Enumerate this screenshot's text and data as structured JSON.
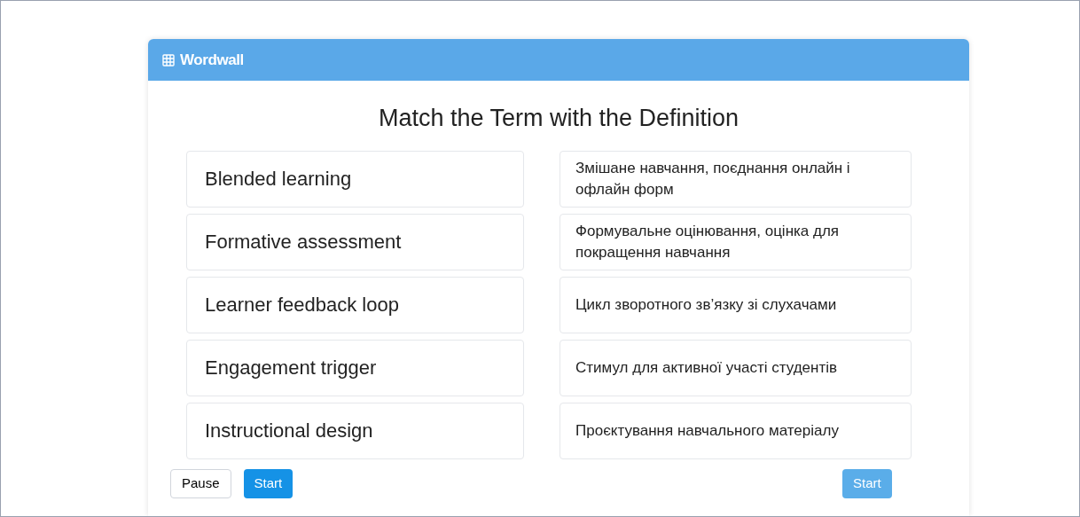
{
  "header": {
    "brand": "Wordwall"
  },
  "title": "Match the Term with the Definition",
  "terms": [
    "Blended learning",
    "Formative assessment",
    "Learner feedback loop",
    "Engagement trigger",
    "Instructional design"
  ],
  "definitions": [
    "Змішане навчання, поєднання онлайн і офлайн форм",
    "Формувальне оцінювання, оцінка для покращення навчання",
    "Цикл зворотного зв’язку зі слухачами",
    "Стимул для активної участі студентів",
    "Проєктування навчального матеріалу"
  ],
  "left_buttons": [
    {
      "label": "Pause",
      "kind": "outline"
    },
    {
      "label": "Start",
      "kind": "primary"
    }
  ],
  "right_button": {
    "label": "Start",
    "kind": "primary",
    "disabled": true
  }
}
